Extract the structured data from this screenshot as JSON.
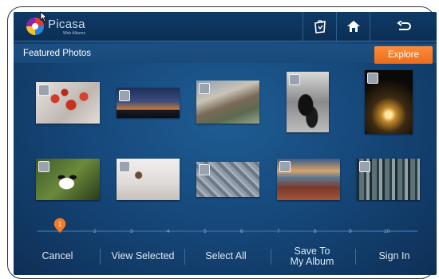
{
  "app": {
    "logo_text": "Picasa",
    "logo_subtext": "Web Albums"
  },
  "header": {
    "title": "Featured Photos",
    "explore_label": "Explore"
  },
  "toolbar_icons": [
    "shopping-bag-icon",
    "home-icon",
    "back-icon"
  ],
  "photos": [
    {
      "subject": "red berries in snow"
    },
    {
      "subject": "city skyline at dusk"
    },
    {
      "subject": "busy street"
    },
    {
      "subject": "penguins"
    },
    {
      "subject": "lamp at night"
    },
    {
      "subject": "panda"
    },
    {
      "subject": "small object on mist"
    },
    {
      "subject": "stone texture"
    },
    {
      "subject": "rocky shore sunset"
    },
    {
      "subject": "misty forest"
    }
  ],
  "pager": {
    "current": "1",
    "ticks": [
      "2",
      "3",
      "4",
      "5",
      "6",
      "7",
      "8",
      "9",
      "10"
    ]
  },
  "bottom": {
    "cancel": "Cancel",
    "view_selected": "View Selected",
    "select_all": "Select All",
    "save_line1": "Save To",
    "save_line2": "My Album",
    "sign_in": "Sign In"
  },
  "colors": {
    "accent_orange": "#f37b27",
    "background_blue": "#16497c"
  }
}
